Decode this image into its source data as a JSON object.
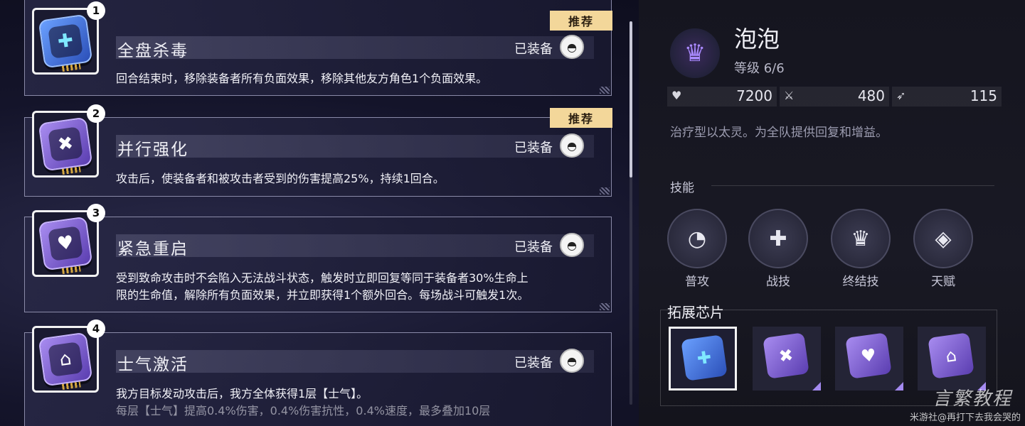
{
  "chip_list": [
    {
      "num": "1",
      "name": "全盘杀毒",
      "status": "已装备",
      "recommend": "推荐",
      "color": "blue",
      "glyph": "✚",
      "desc": [
        "回合结束时，移除装备者所有负面效果，移除其他友方角色1个负面效果。"
      ]
    },
    {
      "num": "2",
      "name": "并行强化",
      "status": "已装备",
      "recommend": "推荐",
      "color": "purple",
      "glyph": "✖",
      "desc": [
        "攻击后，使装备者和被攻击者受到的伤害提高25%，持续1回合。"
      ]
    },
    {
      "num": "3",
      "name": "紧急重启",
      "status": "已装备",
      "recommend": "",
      "color": "purple",
      "glyph": "♥",
      "desc": [
        "受到致命攻击时不会陷入无法战斗状态，触发时立即回复等同于装备者30%生命上",
        "限的生命值，解除所有负面效果，并立即获得1个额外回合。每场战斗可触发1次。"
      ]
    },
    {
      "num": "4",
      "name": "士气激活",
      "status": "已装备",
      "recommend": "",
      "color": "purple",
      "glyph": "⌂",
      "desc": [
        "我方目标发动攻击后，我方全体获得1层【士气】。",
        "每层【士气】提高0.4%伤害，0.4%伤害抗性，0.4%速度，最多叠加10层"
      ]
    }
  ],
  "character": {
    "name": "泡泡",
    "level": "等级 6/6",
    "stats": [
      {
        "icon": "heart-icon",
        "glyph": "♥",
        "value": "7200"
      },
      {
        "icon": "sword-icon",
        "glyph": "⚔",
        "value": "480"
      },
      {
        "icon": "boot-icon",
        "glyph": "➶",
        "value": "115"
      }
    ],
    "description": "治疗型以太灵。为全队提供回复和增益。"
  },
  "skills_title": "技能",
  "skills": [
    {
      "label": "普攻",
      "glyph": "◔"
    },
    {
      "label": "战技",
      "glyph": "✚"
    },
    {
      "label": "终结技",
      "glyph": "♛"
    },
    {
      "label": "天赋",
      "glyph": "◈"
    }
  ],
  "chips_title": "拓展芯片",
  "mini_chips": [
    {
      "color": "blue",
      "glyph": "✚",
      "selected": true
    },
    {
      "color": "purple",
      "glyph": "✖",
      "selected": false
    },
    {
      "color": "purple",
      "glyph": "♥",
      "selected": false
    },
    {
      "color": "purple",
      "glyph": "⌂",
      "selected": false
    }
  ],
  "watermark": {
    "line1": "言繁教程",
    "line2": "米游社@再打下去我会哭的"
  }
}
